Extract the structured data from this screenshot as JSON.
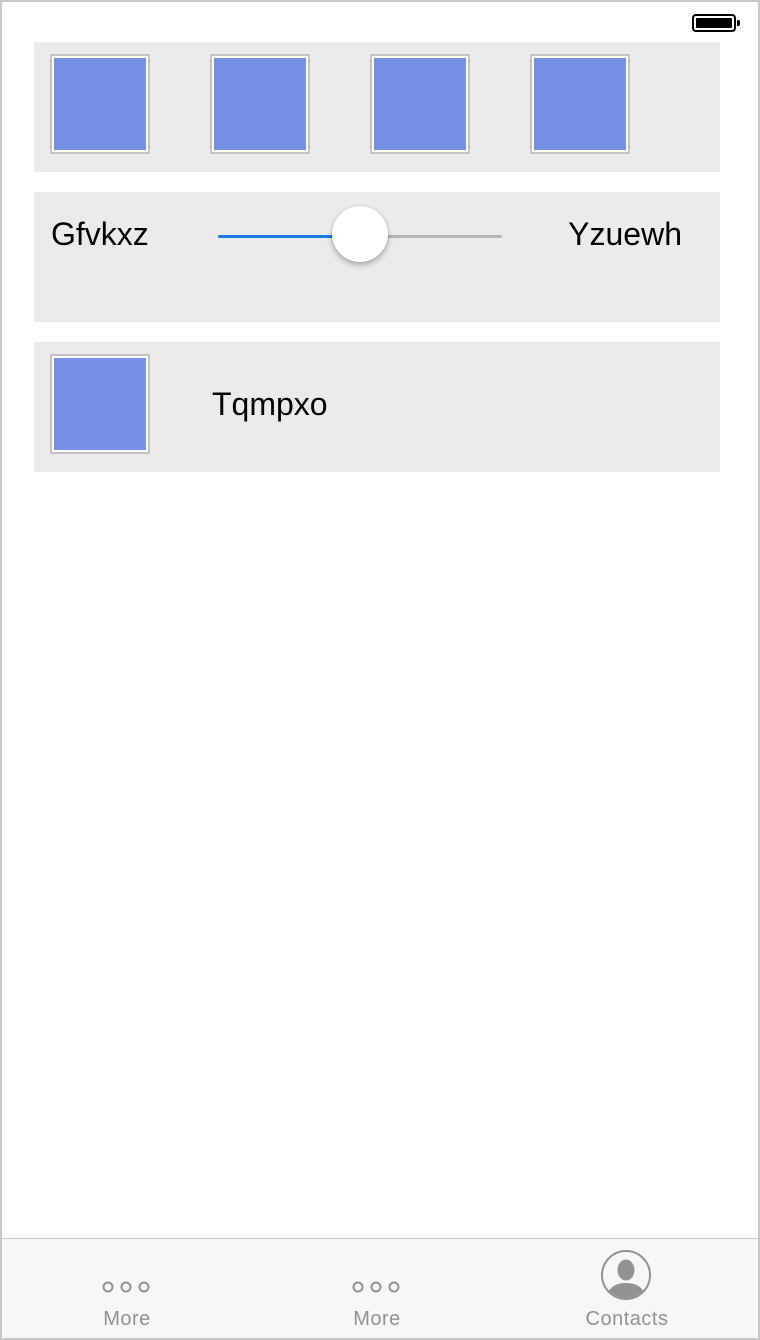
{
  "status_bar": {
    "battery_icon": "battery-full-icon"
  },
  "image_panel": {
    "images": [
      {
        "icon": "image-placeholder",
        "color": "#7890e4"
      },
      {
        "icon": "image-placeholder",
        "color": "#7890e4"
      },
      {
        "icon": "image-placeholder",
        "color": "#7890e4"
      },
      {
        "icon": "image-placeholder",
        "color": "#7890e4"
      }
    ]
  },
  "slider_panel": {
    "min_label": "Gfvkxz",
    "max_label": "Yzuewh",
    "value_fraction": 0.5,
    "track_color": "#b7b7b7",
    "fill_color": "#1a7ae6"
  },
  "row_panel": {
    "image_color": "#7890e4",
    "label": "Tqmpxo"
  },
  "tab_bar": {
    "tabs": [
      {
        "label": "More",
        "icon": "more-icon"
      },
      {
        "label": "More",
        "icon": "more-icon"
      },
      {
        "label": "Contacts",
        "icon": "contacts-icon"
      }
    ]
  }
}
